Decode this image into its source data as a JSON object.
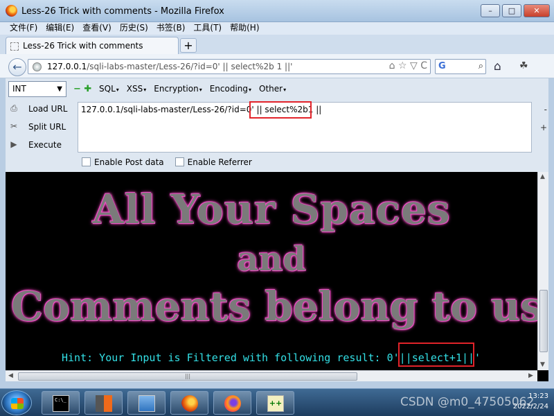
{
  "window": {
    "title": "Less-26 Trick with comments - Mozilla Firefox",
    "minimize_label": "–",
    "maximize_label": "□",
    "close_label": "✕"
  },
  "menu": [
    "文件(F)",
    "编辑(E)",
    "查看(V)",
    "历史(S)",
    "书签(B)",
    "工具(T)",
    "帮助(H)"
  ],
  "tab": {
    "label": "Less-26 Trick with comments",
    "new_tab_label": "+"
  },
  "navbar": {
    "back_label": "←",
    "url_host": "127.0.0.1",
    "url_path": "/sqli-labs-master/Less-26/?id=0' || select%2b 1 ||'",
    "url_icons": "⌂ ☆ ▽ C",
    "search_placeholder": "G",
    "home_label": "⌂"
  },
  "hackbar": {
    "select_value": "INT",
    "menus": [
      "SQL",
      "XSS",
      "Encryption",
      "Encoding",
      "Other"
    ],
    "actions": [
      {
        "label": "Load URL",
        "icon": "load-icon"
      },
      {
        "label": "Split URL",
        "icon": "split-icon"
      },
      {
        "label": "Execute",
        "icon": "execute-icon"
      }
    ],
    "url_text": "127.0.0.1/sqli-labs-master/Less-26/?id=0' || select%2b1 ||",
    "side_minus": "-",
    "side_plus": "+",
    "enable_post": "Enable Post data",
    "enable_referrer": "Enable Referrer"
  },
  "content": {
    "banner_line1": "All Your Spaces",
    "banner_line2": "and",
    "banner_line3": "Comments belong to us",
    "hint_prefix": "Hint: Your Input is Filtered with following result: 0'",
    "hint_filtered": "||select+1||",
    "hint_suffix": "'"
  },
  "taskbar": {
    "apps": [
      "cmd",
      "burp-suite",
      "network",
      "firefox",
      "firefox-dev",
      "notepad-plus-plus"
    ],
    "cmd_label": "C:\\_",
    "np_label": "++",
    "time": "13:23",
    "date": "2022/2/24"
  },
  "watermark": "CSDN @m0_47505062",
  "colors": {
    "hint_text": "#33e0e6",
    "highlight_box": "#e2232a",
    "banner_glow": "#ff3cc6"
  }
}
